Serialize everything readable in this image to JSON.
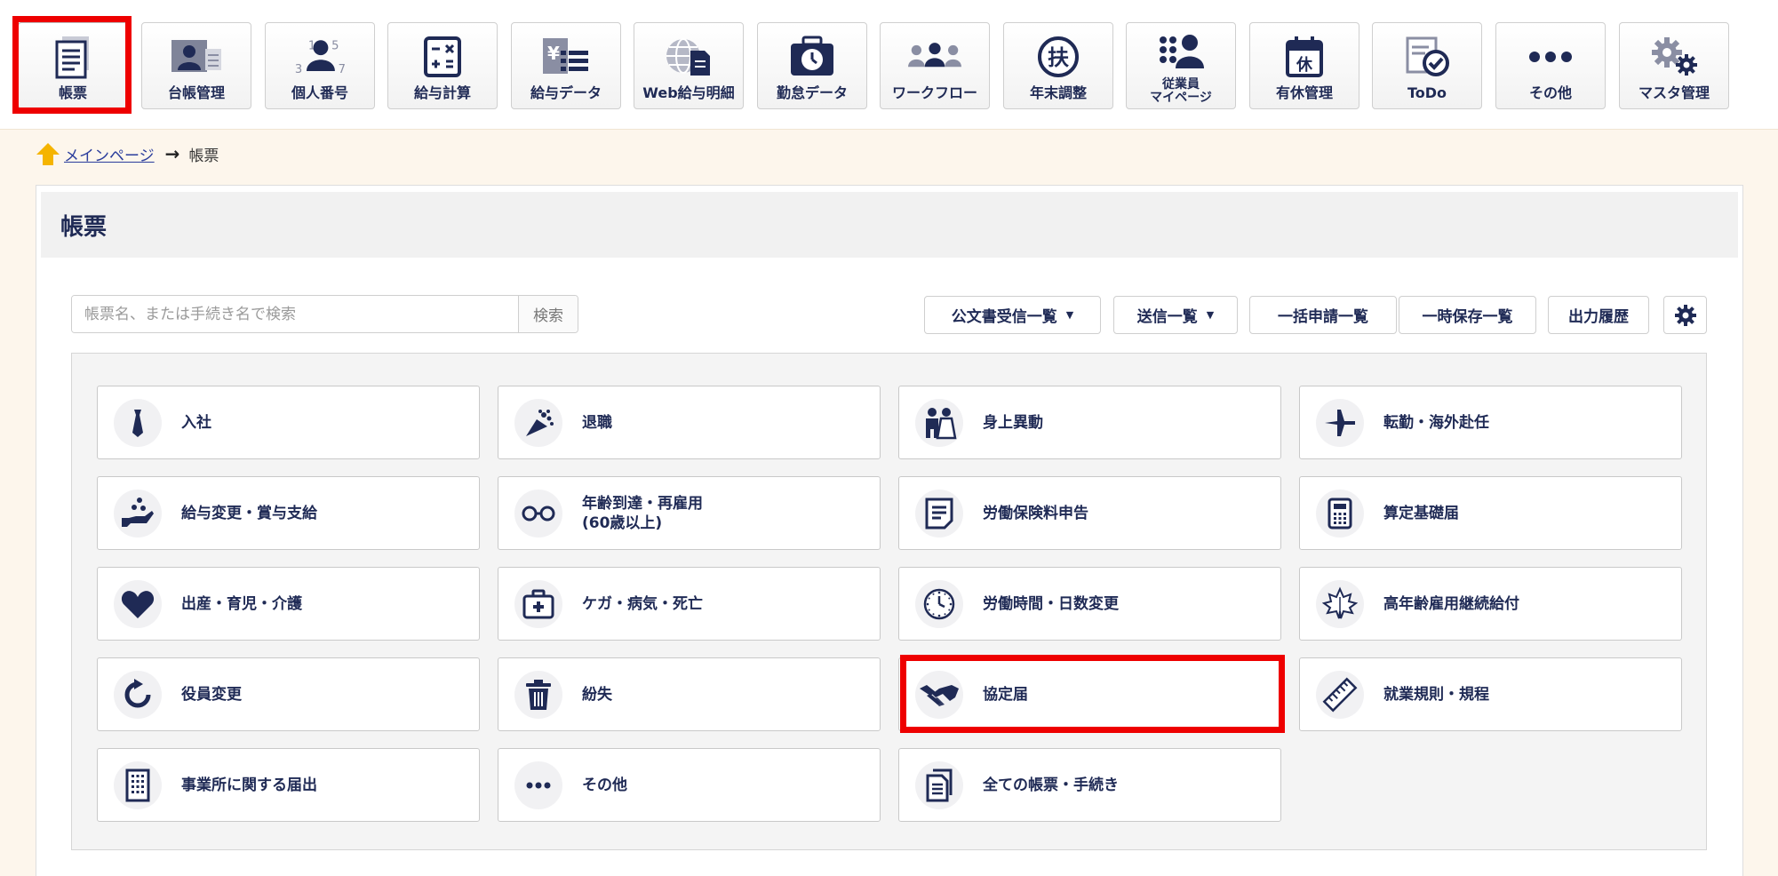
{
  "toolbar": {
    "items": [
      {
        "id": "form",
        "label": "帳票",
        "icon": "document-icon"
      },
      {
        "id": "ledger",
        "label": "台帳管理",
        "icon": "id-card-icon"
      },
      {
        "id": "mynumber",
        "label": "個人番号",
        "icon": "person-number-icon"
      },
      {
        "id": "payroll",
        "label": "給与計算",
        "icon": "calculator-icon"
      },
      {
        "id": "paydata",
        "label": "給与データ",
        "icon": "yen-list-icon"
      },
      {
        "id": "webpay",
        "label": "Web給与明細",
        "icon": "globe-document-icon"
      },
      {
        "id": "attendance",
        "label": "勤怠データ",
        "icon": "clock-bag-icon"
      },
      {
        "id": "workflow",
        "label": "ワークフロー",
        "icon": "people-flow-icon"
      },
      {
        "id": "yearend",
        "label": "年末調整",
        "icon": "fu-circle-icon"
      },
      {
        "id": "mypage",
        "label": "従業員マイページ",
        "label_line1": "従業員",
        "label_line2": "マイページ",
        "icon": "employee-icon"
      },
      {
        "id": "paidleave",
        "label": "有休管理",
        "icon": "calendar-leave-icon"
      },
      {
        "id": "todo",
        "label": "ToDo",
        "icon": "todo-check-icon"
      },
      {
        "id": "other",
        "label": "その他",
        "icon": "dots-icon"
      },
      {
        "id": "master",
        "label": "マスタ管理",
        "icon": "gears-icon"
      }
    ],
    "active": "form"
  },
  "breadcrumb": {
    "home": "メインページ",
    "current": "帳票"
  },
  "page": {
    "title": "帳票"
  },
  "search": {
    "placeholder": "帳票名、または手続き名で検索",
    "button": "検索"
  },
  "actions": {
    "public_docs": "公文書受信一覧",
    "sent_list": "送信一覧",
    "bulk_list": "一括申請一覧",
    "saved_list": "一時保存一覧",
    "output_history": "出力履歴",
    "settings_icon": "gear-icon"
  },
  "tiles": [
    {
      "label": "入社",
      "icon": "necktie-icon"
    },
    {
      "label": "退職",
      "icon": "bouquet-icon"
    },
    {
      "label": "身上異動",
      "icon": "wedding-couple-icon"
    },
    {
      "label": "転勤・海外赴任",
      "icon": "airplane-icon"
    },
    {
      "label": "給与変更・賞与支給",
      "icon": "hand-coins-icon"
    },
    {
      "label": "年齢到達・再雇用",
      "label2": "(60歳以上)",
      "icon": "glasses-icon"
    },
    {
      "label": "労働保険料申告",
      "icon": "document-lines-icon"
    },
    {
      "label": "算定基礎届",
      "icon": "calculator-icon"
    },
    {
      "label": "出産・育児・介護",
      "icon": "heart-icon"
    },
    {
      "label": "ケガ・病気・死亡",
      "icon": "first-aid-kit-icon"
    },
    {
      "label": "労働時間・日数変更",
      "icon": "clock-icon"
    },
    {
      "label": "高年齢雇用継続給付",
      "icon": "maple-leaf-icon"
    },
    {
      "label": "役員変更",
      "icon": "refresh-icon"
    },
    {
      "label": "紛失",
      "icon": "trash-icon"
    },
    {
      "label": "協定届",
      "icon": "handshake-icon"
    },
    {
      "label": "就業規則・規程",
      "icon": "ruler-icon"
    },
    {
      "label": "事業所に関する届出",
      "icon": "building-icon"
    },
    {
      "label": "その他",
      "icon": "dots-icon"
    },
    {
      "label": "全ての帳票・手続き",
      "icon": "documents-icon"
    }
  ],
  "highlight": {
    "toolbar_item": "帳票",
    "tile": "協定届",
    "color": "#ee0000"
  },
  "colors": {
    "navy": "#1f2a55",
    "page_bg": "#fdf6ec",
    "link": "#2b3d9c",
    "home_icon": "#f5b400"
  }
}
